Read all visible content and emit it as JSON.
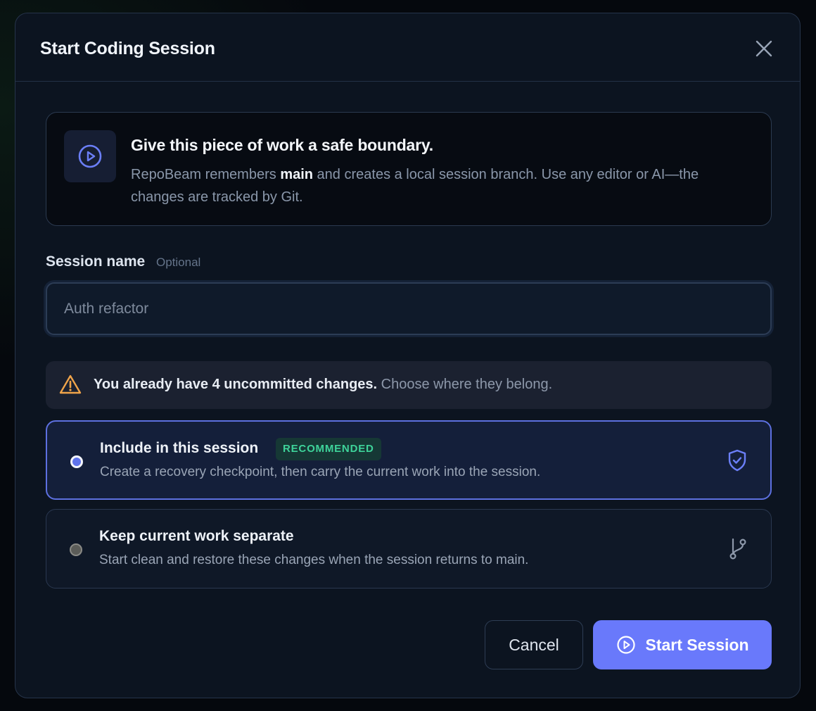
{
  "dialog": {
    "title": "Start Coding Session",
    "close_icon": "close-icon"
  },
  "info": {
    "icon": "play-circle-icon",
    "heading": "Give this piece of work a safe boundary.",
    "body_prefix": "RepoBeam remembers ",
    "body_branch": "main",
    "body_suffix": " and creates a local session branch. Use any editor or AI—the changes are tracked by Git."
  },
  "session_name": {
    "label": "Session name",
    "optional": "Optional",
    "placeholder": "Auth refactor",
    "value": ""
  },
  "warning": {
    "icon": "warning-triangle-icon",
    "strong": "You already have 4 uncommitted changes.",
    "rest": " Choose where they belong."
  },
  "options": [
    {
      "title": "Include in this session",
      "badge": "RECOMMENDED",
      "description": "Create a recovery checkpoint, then carry the current work into the session.",
      "icon": "shield-check-icon",
      "selected": true
    },
    {
      "title": "Keep current work separate",
      "description": "Start clean and restore these changes when the session returns to main.",
      "icon": "git-branch-icon",
      "selected": false
    }
  ],
  "actions": {
    "cancel_label": "Cancel",
    "start_label": "Start Session",
    "start_icon": "play-circle-icon"
  },
  "colors": {
    "accent": "#6979fb",
    "badge_text": "#3ed39a",
    "warning": "#f0a44a",
    "surface": "#0c1420"
  }
}
